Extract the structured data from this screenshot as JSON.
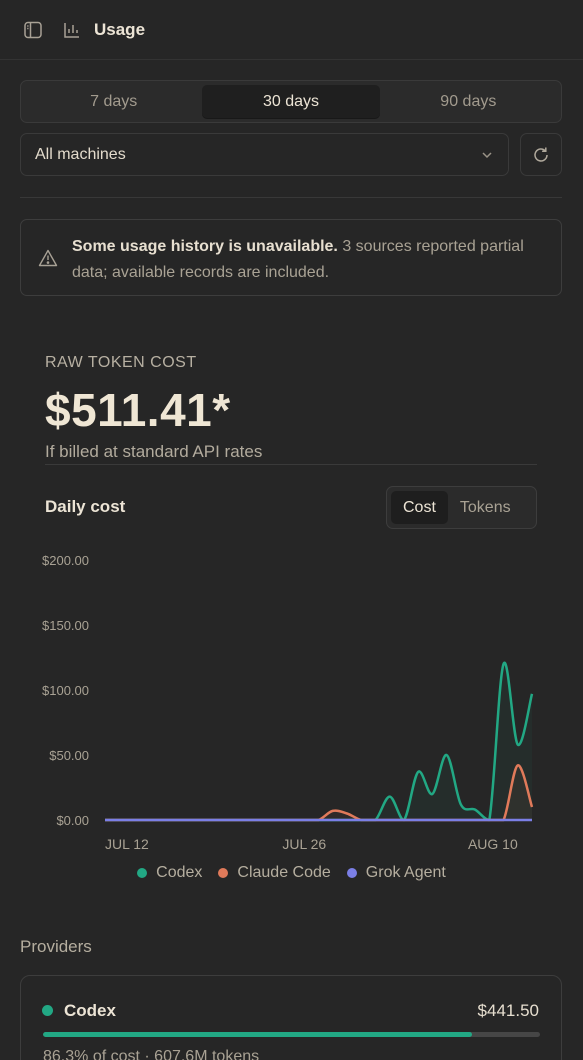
{
  "header": {
    "title": "Usage",
    "sidebar_icon": "sidebar-toggle-icon",
    "chart_icon": "bar-chart-icon"
  },
  "range_tabs": [
    {
      "label": "7 days",
      "active": false
    },
    {
      "label": "30 days",
      "active": true
    },
    {
      "label": "90 days",
      "active": false
    }
  ],
  "machine_select": {
    "value": "All machines"
  },
  "warning": {
    "bold": "Some usage history is unavailable.",
    "text": " 3 sources reported partial data; available records are included."
  },
  "summary": {
    "label": "RAW TOKEN COST",
    "value": "$511.41*",
    "subtitle": "If billed at standard API rates"
  },
  "daily": {
    "title": "Daily cost",
    "toggle": [
      {
        "label": "Cost",
        "active": true
      },
      {
        "label": "Tokens",
        "active": false
      }
    ]
  },
  "colors": {
    "codex": "#22a884",
    "claude": "#e07a5a",
    "grok": "#7b7fe6"
  },
  "chart_data": {
    "type": "line",
    "ylim": [
      0,
      200
    ],
    "y_ticks": [
      "$0.00",
      "$50.00",
      "$100.00",
      "$150.00",
      "$200.00"
    ],
    "y_tick_values": [
      0,
      50,
      100,
      150,
      200
    ],
    "x_tick_labels": [
      "JUL 12",
      "JUL 26",
      "AUG 10"
    ],
    "x_tick_days": [
      0,
      14,
      29
    ],
    "series": [
      {
        "name": "Codex",
        "values": [
          0,
          0,
          0,
          0,
          0,
          0,
          0,
          0,
          0,
          0,
          0,
          0,
          0,
          0,
          0,
          0,
          0,
          0,
          0,
          0,
          18,
          0,
          37,
          20,
          50,
          12,
          8,
          0,
          120,
          58,
          97
        ]
      },
      {
        "name": "Claude Code",
        "values": [
          0,
          0,
          0,
          0,
          0,
          0,
          0,
          0,
          0,
          0,
          0,
          0,
          0,
          0,
          0,
          0,
          7,
          5,
          0,
          0,
          0,
          0,
          0,
          0,
          0,
          0,
          0,
          0,
          0,
          42,
          10
        ]
      },
      {
        "name": "Grok Agent",
        "values": [
          0,
          0,
          0,
          0,
          0,
          0,
          0,
          0,
          0,
          0,
          0,
          0,
          0,
          0,
          0,
          0,
          0,
          0,
          0,
          0,
          0,
          0,
          0,
          0,
          0,
          0,
          0,
          0,
          0,
          0,
          0
        ]
      }
    ]
  },
  "providers": {
    "title": "Providers",
    "items": [
      {
        "name": "Codex",
        "cost": "$441.50",
        "share": 0.863,
        "detail": "86.3% of cost · 607.6M tokens"
      }
    ]
  }
}
